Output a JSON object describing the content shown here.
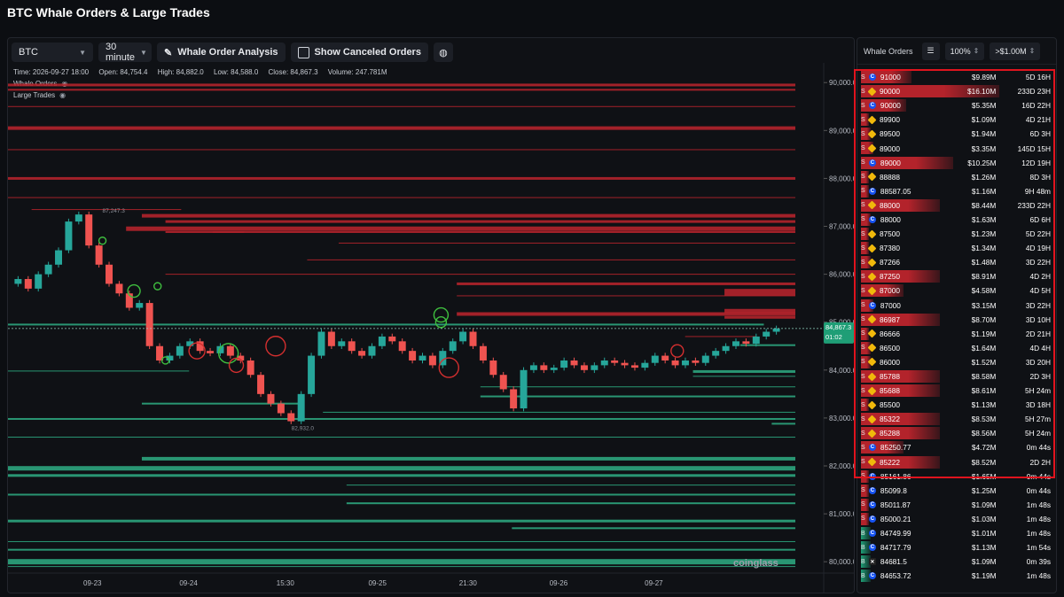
{
  "page_title": "BTC Whale Orders & Large Trades",
  "toolbar": {
    "symbol": "BTC",
    "interval": "30 minute",
    "whale_analysis": "Whale Order Analysis",
    "show_canceled": "Show Canceled Orders"
  },
  "ohlc": {
    "time": "Time: 2026-09-27 18:00",
    "open": "Open: 84,754.4",
    "high": "High: 84,882.0",
    "low": "Low: 84,588.0",
    "close": "Close: 84,867.3",
    "volume": "Volume: 247.781M"
  },
  "legend": {
    "whale_orders": "Whale Orders",
    "large_trades": "Large Trades"
  },
  "chart_data": {
    "type": "candlestick",
    "y_ticks": [
      "90,000.0",
      "89,000.0",
      "88,000.0",
      "87,000.0",
      "86,000.0",
      "85,000.0",
      "84,000.0",
      "83,000.0",
      "82,000.0",
      "81,000.0",
      "80,000.0"
    ],
    "x_ticks": [
      "09-23",
      "09-24",
      "15:30",
      "09-25",
      "21:30",
      "09-26",
      "09-27"
    ],
    "ylim": [
      79800,
      90300
    ],
    "current_price": "84,867.3",
    "countdown": "01:02",
    "high_marker": "87,247.3",
    "low_marker": "82,932.0",
    "watermark": "coinglass",
    "price_path": [
      85800,
      85900,
      85700,
      86000,
      86200,
      86500,
      87100,
      87247,
      86600,
      86200,
      85800,
      85600,
      85300,
      85400,
      84500,
      84200,
      84300,
      84500,
      84600,
      84400,
      84350,
      84500,
      84300,
      84200,
      83900,
      83500,
      83300,
      83100,
      82932,
      83500,
      84300,
      84800,
      84500,
      84600,
      84400,
      84300,
      84500,
      84700,
      84600,
      84400,
      84200,
      84300,
      84100,
      84400,
      84600,
      84800,
      84500,
      84200,
      83900,
      83600,
      83200,
      84000,
      84100,
      84000,
      84050,
      84200,
      84100,
      84000,
      84100,
      84200,
      84150,
      84100,
      84050,
      84150,
      84300,
      84200,
      84100,
      84200,
      84150,
      84300,
      84400,
      84500,
      84600,
      84550,
      84700,
      84800,
      84867
    ]
  },
  "book": {
    "asks": [
      {
        "start": 0.0,
        "end": 1.0,
        "y": 89950,
        "w": 3
      },
      {
        "start": 0.0,
        "end": 1.0,
        "y": 89850,
        "w": 2
      },
      {
        "start": 0.0,
        "end": 1.0,
        "y": 89500,
        "w": 1
      },
      {
        "start": 0.0,
        "end": 1.0,
        "y": 89050,
        "w": 4
      },
      {
        "start": 0.0,
        "end": 1.0,
        "y": 88600,
        "w": 1
      },
      {
        "start": 0.0,
        "end": 1.0,
        "y": 88000,
        "w": 3
      },
      {
        "start": 0.0,
        "end": 1.0,
        "y": 87600,
        "w": 1
      },
      {
        "start": 0.03,
        "end": 0.22,
        "y": 87350,
        "w": 1
      },
      {
        "start": 0.17,
        "end": 1.0,
        "y": 87220,
        "w": 4
      },
      {
        "start": 0.2,
        "end": 1.0,
        "y": 87100,
        "w": 3
      },
      {
        "start": 0.15,
        "end": 1.0,
        "y": 86950,
        "w": 5
      },
      {
        "start": 0.2,
        "end": 1.0,
        "y": 86880,
        "w": 2
      },
      {
        "start": 0.26,
        "end": 0.3,
        "y": 86880,
        "w": 1
      },
      {
        "start": 0.42,
        "end": 1.0,
        "y": 86650,
        "w": 1
      },
      {
        "start": 0.38,
        "end": 1.0,
        "y": 86300,
        "w": 1
      },
      {
        "start": 0.2,
        "end": 1.0,
        "y": 86000,
        "w": 1
      },
      {
        "start": 0.57,
        "end": 1.0,
        "y": 85800,
        "w": 3
      },
      {
        "start": 0.91,
        "end": 1.0,
        "y": 85620,
        "w": 8
      },
      {
        "start": 0.57,
        "end": 1.0,
        "y": 85550,
        "w": 1
      },
      {
        "start": 0.91,
        "end": 1.0,
        "y": 85230,
        "w": 5
      },
      {
        "start": 0.57,
        "end": 1.0,
        "y": 85170,
        "w": 4
      },
      {
        "start": 0.91,
        "end": 1.0,
        "y": 85100,
        "w": 3
      },
      {
        "start": 0.86,
        "end": 0.95,
        "y": 84700,
        "w": 1
      }
    ],
    "bids": [
      {
        "start": 0.0,
        "end": 0.96,
        "y": 84950,
        "w": 2
      },
      {
        "start": 0.93,
        "end": 1.0,
        "y": 84520,
        "w": 2
      },
      {
        "start": 0.87,
        "end": 1.0,
        "y": 83970,
        "w": 3
      },
      {
        "start": 0.0,
        "end": 0.23,
        "y": 83980,
        "w": 1
      },
      {
        "start": 0.87,
        "end": 1.0,
        "y": 83870,
        "w": 1
      },
      {
        "start": 0.6,
        "end": 1.0,
        "y": 83650,
        "w": 1
      },
      {
        "start": 0.6,
        "end": 1.0,
        "y": 83450,
        "w": 2
      },
      {
        "start": 0.17,
        "end": 0.37,
        "y": 83300,
        "w": 2
      },
      {
        "start": 0.4,
        "end": 1.0,
        "y": 83120,
        "w": 1
      },
      {
        "start": 0.0,
        "end": 1.0,
        "y": 82980,
        "w": 2
      },
      {
        "start": 0.97,
        "end": 1.0,
        "y": 82880,
        "w": 2
      },
      {
        "start": 0.0,
        "end": 1.0,
        "y": 82600,
        "w": 1
      },
      {
        "start": 0.17,
        "end": 1.0,
        "y": 82150,
        "w": 4
      },
      {
        "start": 0.0,
        "end": 1.0,
        "y": 81950,
        "w": 5
      },
      {
        "start": 0.0,
        "end": 1.0,
        "y": 81800,
        "w": 3
      },
      {
        "start": 0.43,
        "end": 1.0,
        "y": 81600,
        "w": 1
      },
      {
        "start": 0.0,
        "end": 1.0,
        "y": 81400,
        "w": 2
      },
      {
        "start": 0.43,
        "end": 1.0,
        "y": 81220,
        "w": 2
      },
      {
        "start": 0.0,
        "end": 1.0,
        "y": 80850,
        "w": 3
      },
      {
        "start": 0.64,
        "end": 1.0,
        "y": 80700,
        "w": 2
      },
      {
        "start": 0.0,
        "end": 1.0,
        "y": 80420,
        "w": 1
      },
      {
        "start": 0.0,
        "end": 1.0,
        "y": 80250,
        "w": 2
      },
      {
        "start": 0.0,
        "end": 1.0,
        "y": 80000,
        "w": 6
      },
      {
        "start": 0.0,
        "end": 1.0,
        "y": 79900,
        "w": 1
      }
    ]
  },
  "side_panel": {
    "title": "Whale Orders",
    "zoom": "100%",
    "filter": ">$1.00M",
    "rows": [
      {
        "side": "S",
        "ex": "coinbase",
        "price": "91000",
        "amount": "$9.89M",
        "age": "5D 16H",
        "kind": "ask",
        "fill": 0.34
      },
      {
        "side": "S",
        "ex": "binance",
        "price": "90000",
        "amount": "$16.10M",
        "age": "233D 23H",
        "kind": "ask",
        "fill": 1.0
      },
      {
        "side": "S",
        "ex": "coinbase",
        "price": "90000",
        "amount": "$5.35M",
        "age": "16D 22H",
        "kind": "ask",
        "fill": 0.3
      },
      {
        "side": "S",
        "ex": "binance",
        "price": "89900",
        "amount": "$1.09M",
        "age": "4D 21H",
        "kind": "ask",
        "fill": 0.02
      },
      {
        "side": "S",
        "ex": "binance",
        "price": "89500",
        "amount": "$1.94M",
        "age": "6D 3H",
        "kind": "ask",
        "fill": 0.03
      },
      {
        "side": "S",
        "ex": "binance",
        "price": "89000",
        "amount": "$3.35M",
        "age": "145D 15H",
        "kind": "ask",
        "fill": 0.05
      },
      {
        "side": "S",
        "ex": "coinbase",
        "price": "89000",
        "amount": "$10.25M",
        "age": "12D 19H",
        "kind": "ask",
        "fill": 0.65
      },
      {
        "side": "S",
        "ex": "binance",
        "price": "88888",
        "amount": "$1.26M",
        "age": "8D 3H",
        "kind": "ask",
        "fill": 0.02
      },
      {
        "side": "S",
        "ex": "coinbase",
        "price": "88587.05",
        "amount": "$1.16M",
        "age": "9H 48m",
        "kind": "ask",
        "fill": 0.02
      },
      {
        "side": "S",
        "ex": "binance",
        "price": "88000",
        "amount": "$8.44M",
        "age": "233D 22H",
        "kind": "ask",
        "fill": 0.55
      },
      {
        "side": "S",
        "ex": "coinbase",
        "price": "88000",
        "amount": "$1.63M",
        "age": "6D 6H",
        "kind": "ask",
        "fill": 0.03
      },
      {
        "side": "S",
        "ex": "binance",
        "price": "87500",
        "amount": "$1.23M",
        "age": "5D 22H",
        "kind": "ask",
        "fill": 0.02
      },
      {
        "side": "S",
        "ex": "binance",
        "price": "87380",
        "amount": "$1.34M",
        "age": "4D 19H",
        "kind": "ask",
        "fill": 0.02
      },
      {
        "side": "S",
        "ex": "binance",
        "price": "87266",
        "amount": "$1.48M",
        "age": "3D 22H",
        "kind": "ask",
        "fill": 0.03
      },
      {
        "side": "S",
        "ex": "binance",
        "price": "87250",
        "amount": "$8.91M",
        "age": "4D 2H",
        "kind": "ask",
        "fill": 0.55
      },
      {
        "side": "S",
        "ex": "binance",
        "price": "87000",
        "amount": "$4.58M",
        "age": "4D 5H",
        "kind": "ask",
        "fill": 0.28
      },
      {
        "side": "S",
        "ex": "coinbase",
        "price": "87000",
        "amount": "$3.15M",
        "age": "3D 22H",
        "kind": "ask",
        "fill": 0.05
      },
      {
        "side": "S",
        "ex": "binance",
        "price": "86987",
        "amount": "$8.70M",
        "age": "3D 10H",
        "kind": "ask",
        "fill": 0.55
      },
      {
        "side": "S",
        "ex": "binance",
        "price": "86666",
        "amount": "$1.19M",
        "age": "2D 21H",
        "kind": "ask",
        "fill": 0.02
      },
      {
        "side": "S",
        "ex": "binance",
        "price": "86500",
        "amount": "$1.64M",
        "age": "4D 4H",
        "kind": "ask",
        "fill": 0.03
      },
      {
        "side": "S",
        "ex": "binance",
        "price": "86000",
        "amount": "$1.52M",
        "age": "3D 20H",
        "kind": "ask",
        "fill": 0.03
      },
      {
        "side": "S",
        "ex": "binance",
        "price": "85788",
        "amount": "$8.58M",
        "age": "2D 3H",
        "kind": "ask",
        "fill": 0.55
      },
      {
        "side": "S",
        "ex": "binance",
        "price": "85688",
        "amount": "$8.61M",
        "age": "5H 24m",
        "kind": "ask",
        "fill": 0.55
      },
      {
        "side": "S",
        "ex": "binance",
        "price": "85500",
        "amount": "$1.13M",
        "age": "3D 18H",
        "kind": "ask",
        "fill": 0.02
      },
      {
        "side": "S",
        "ex": "binance",
        "price": "85322",
        "amount": "$8.53M",
        "age": "5H 27m",
        "kind": "ask",
        "fill": 0.55
      },
      {
        "side": "S",
        "ex": "binance",
        "price": "85288",
        "amount": "$8.56M",
        "age": "5H 24m",
        "kind": "ask",
        "fill": 0.55
      },
      {
        "side": "S",
        "ex": "coinbase",
        "price": "85250.77",
        "amount": "$4.72M",
        "age": "0m 44s",
        "kind": "ask",
        "fill": 0.28
      },
      {
        "side": "S",
        "ex": "binance",
        "price": "85222",
        "amount": "$8.52M",
        "age": "2D 2H",
        "kind": "ask",
        "fill": 0.55
      },
      {
        "side": "S",
        "ex": "coinbase",
        "price": "85161.86",
        "amount": "$1.65M",
        "age": "0m 44s",
        "kind": "ask",
        "fill": 0.02
      },
      {
        "side": "S",
        "ex": "coinbase",
        "price": "85099.8",
        "amount": "$1.25M",
        "age": "0m 44s",
        "kind": "ask",
        "fill": 0.02
      },
      {
        "side": "S",
        "ex": "coinbase",
        "price": "85011.87",
        "amount": "$1.09M",
        "age": "1m 48s",
        "kind": "ask",
        "fill": 0.02
      },
      {
        "side": "S",
        "ex": "coinbase",
        "price": "85000.21",
        "amount": "$1.03M",
        "age": "1m 48s",
        "kind": "ask",
        "fill": 0.02
      },
      {
        "side": "B",
        "ex": "coinbase",
        "price": "84749.99",
        "amount": "$1.01M",
        "age": "1m 48s",
        "kind": "bid",
        "fill": 0.03
      },
      {
        "side": "B",
        "ex": "coinbase",
        "price": "84717.79",
        "amount": "$1.13M",
        "age": "1m 54s",
        "kind": "bid",
        "fill": 0.03
      },
      {
        "side": "B",
        "ex": "okx",
        "price": "84681.5",
        "amount": "$1.09M",
        "age": "0m 39s",
        "kind": "bid",
        "fill": 0.03
      },
      {
        "side": "B",
        "ex": "coinbase",
        "price": "84653.72",
        "amount": "$1.19M",
        "age": "1m 48s",
        "kind": "bid",
        "fill": 0.03
      }
    ]
  }
}
